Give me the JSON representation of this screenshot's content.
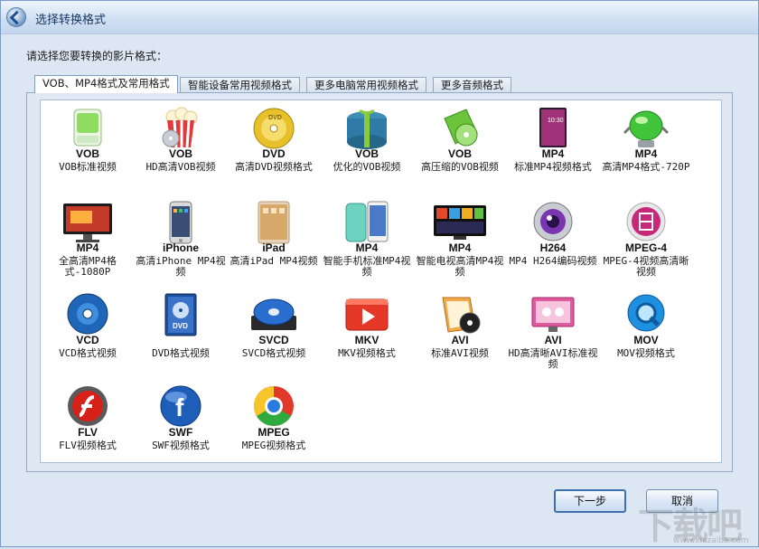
{
  "window": {
    "title": "选择转换格式"
  },
  "prompt": "请选择您要转换的影片格式：",
  "tabs": [
    {
      "label": "VOB、MP4格式及常用格式",
      "active": true
    },
    {
      "label": "智能设备常用视频格式",
      "active": false
    },
    {
      "label": "更多电脑常用视频格式",
      "active": false
    },
    {
      "label": "更多音频格式",
      "active": false
    }
  ],
  "formats": [
    {
      "format": "VOB",
      "desc": "VOB标准视频",
      "icon": "usb-drive-icon"
    },
    {
      "format": "VOB",
      "desc": "HD高清VOB视频",
      "icon": "popcorn-icon"
    },
    {
      "format": "DVD",
      "desc": "高清DVD视频格式",
      "icon": "gold-disc-icon"
    },
    {
      "format": "VOB",
      "desc": "优化的VOB视频",
      "icon": "gift-box-icon"
    },
    {
      "format": "VOB",
      "desc": "高压缩的VOB视频",
      "icon": "green-disc-box-icon"
    },
    {
      "format": "MP4",
      "desc": "标准MP4视频格式",
      "icon": "phone-screen-icon"
    },
    {
      "format": "MP4",
      "desc": "高清MP4格式-720P",
      "icon": "green-robot-icon"
    },
    {
      "format": "MP4",
      "desc": "全高清MP4格式-1080P",
      "icon": "monitor-icon"
    },
    {
      "format": "iPhone",
      "desc": "高清iPhone MP4视频",
      "icon": "iphone-icon"
    },
    {
      "format": "iPad",
      "desc": "高清iPad MP4视频",
      "icon": "ipad-icon"
    },
    {
      "format": "MP4",
      "desc": "智能手机标准MP4视频",
      "icon": "smartphones-icon"
    },
    {
      "format": "MP4",
      "desc": "智能电视高清MP4视频",
      "icon": "smart-tv-icon"
    },
    {
      "format": "H264",
      "desc": "MP4 H264编码视频",
      "icon": "purple-eye-icon"
    },
    {
      "format": "MPEG-4",
      "desc": "MPEG-4视频高清晰视频",
      "icon": "film-circle-icon"
    },
    {
      "format": "VCD",
      "desc": "VCD格式视频",
      "icon": "blue-disc-icon"
    },
    {
      "format": "",
      "desc": "DVD格式视频",
      "icon": "dvd-case-icon"
    },
    {
      "format": "SVCD",
      "desc": "SVCD格式视频",
      "icon": "disc-drive-icon"
    },
    {
      "format": "MKV",
      "desc": "MKV视频格式",
      "icon": "red-play-icon"
    },
    {
      "format": "AVI",
      "desc": "标准AVI视频",
      "icon": "photo-disc-icon"
    },
    {
      "format": "AVI",
      "desc": "HD高清晰AVI标准视频",
      "icon": "avi-screen-icon"
    },
    {
      "format": "MOV",
      "desc": "MOV视频格式",
      "icon": "quicktime-icon"
    },
    {
      "format": "FLV",
      "desc": "FLV视频格式",
      "icon": "flash-icon"
    },
    {
      "format": "SWF",
      "desc": "SWF视频格式",
      "icon": "facebook-globe-icon"
    },
    {
      "format": "MPEG",
      "desc": "MPEG视频格式",
      "icon": "chrome-icon"
    }
  ],
  "buttons": {
    "next": "下一步",
    "cancel": "取消"
  },
  "watermark": {
    "main": "下载吧",
    "sub": "www.xiazaiba.com"
  }
}
